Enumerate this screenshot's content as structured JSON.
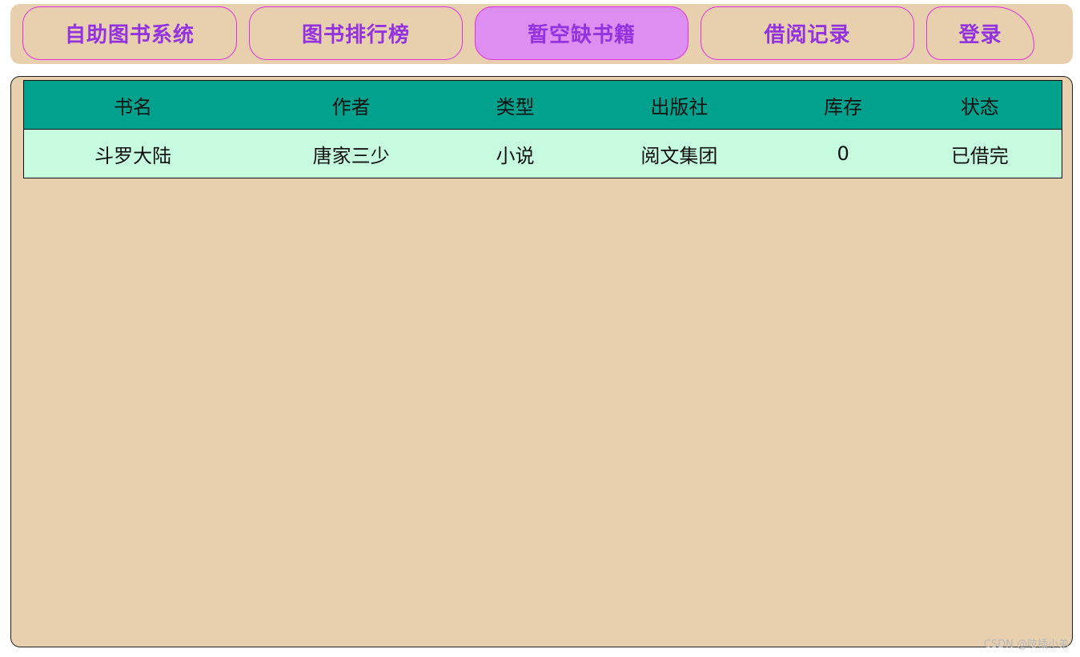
{
  "nav": {
    "items": [
      {
        "label": "自助图书系统"
      },
      {
        "label": "图书排行榜"
      },
      {
        "label": "暂空缺书籍"
      },
      {
        "label": "借阅记录"
      },
      {
        "label": "登录"
      }
    ]
  },
  "table": {
    "headers": [
      "书名",
      "作者",
      "类型",
      "出版社",
      "库存",
      "状态"
    ],
    "rows": [
      [
        "斗罗大陆",
        "唐家三少",
        "小说",
        "阅文集团",
        "0",
        "已借完"
      ]
    ]
  },
  "watermark": "CSDN @吱插小弟",
  "colors": {
    "background": "#e8d0ae",
    "header_row": "#00a28e",
    "data_row": "#c6fbe0",
    "nav_text": "#9333e0",
    "nav_border": "#e030e0",
    "nav_active": "#de8ef0"
  }
}
